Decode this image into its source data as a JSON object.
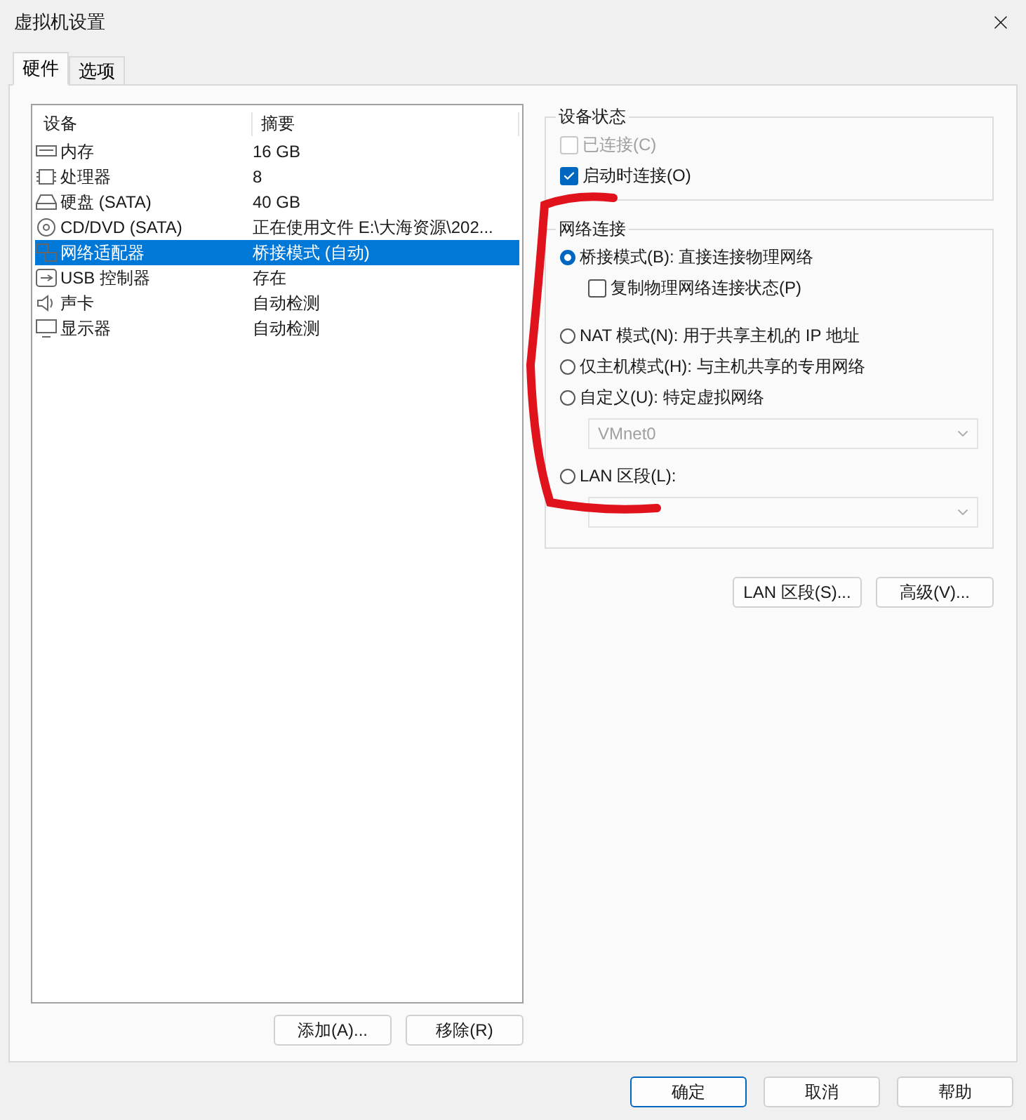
{
  "window": {
    "title": "虚拟机设置"
  },
  "tabs": [
    {
      "label": "硬件",
      "selected": true
    },
    {
      "label": "选项",
      "selected": false
    }
  ],
  "device_table": {
    "columns": [
      "设备",
      "摘要"
    ],
    "rows": [
      {
        "device": "内存",
        "summary": "16 GB",
        "selected": false
      },
      {
        "device": "处理器",
        "summary": "8",
        "selected": false
      },
      {
        "device": "硬盘 (SATA)",
        "summary": "40 GB",
        "selected": false
      },
      {
        "device": "CD/DVD (SATA)",
        "summary": "正在使用文件 E:\\大海资源\\202...",
        "selected": false
      },
      {
        "device": "网络适配器",
        "summary": "桥接模式 (自动)",
        "selected": true
      },
      {
        "device": "USB 控制器",
        "summary": "存在",
        "selected": false
      },
      {
        "device": "声卡",
        "summary": "自动检测",
        "selected": false
      },
      {
        "device": "显示器",
        "summary": "自动检测",
        "selected": false
      }
    ]
  },
  "list_buttons": [
    "添加(A)...",
    "移除(R)"
  ],
  "device_status": {
    "title": "设备状态",
    "options": [
      {
        "label": "已连接(C)",
        "checked": false,
        "disabled": true
      },
      {
        "label": "启动时连接(O)",
        "checked": true
      }
    ]
  },
  "network_connection": {
    "title": "网络连接",
    "items": [
      {
        "kind": "radio",
        "label": "桥接模式(B): 直接连接物理网络",
        "selected": true
      },
      {
        "kind": "checkbox",
        "label": "复制物理网络连接状态(P)",
        "checked": false
      },
      {
        "kind": "radio",
        "label": "NAT 模式(N): 用于共享主机的 IP 地址",
        "selected": false
      },
      {
        "kind": "radio",
        "label": "仅主机模式(H): 与主机共享的专用网络",
        "selected": false
      },
      {
        "kind": "radio",
        "label": "自定义(U): 特定虚拟网络",
        "selected": false
      },
      {
        "kind": "dropdown",
        "value": "VMnet0",
        "disabled": true
      },
      {
        "kind": "radio",
        "label": "LAN 区段(L):",
        "selected": false
      },
      {
        "kind": "dropdown",
        "disabled": true
      }
    ]
  },
  "network_buttons": [
    "LAN 区段(S)...",
    "高级(V)..."
  ],
  "dialog_buttons": [
    {
      "label": "确定",
      "default": true
    },
    {
      "label": "取消",
      "default": false
    },
    {
      "label": "帮助",
      "default": false
    }
  ]
}
